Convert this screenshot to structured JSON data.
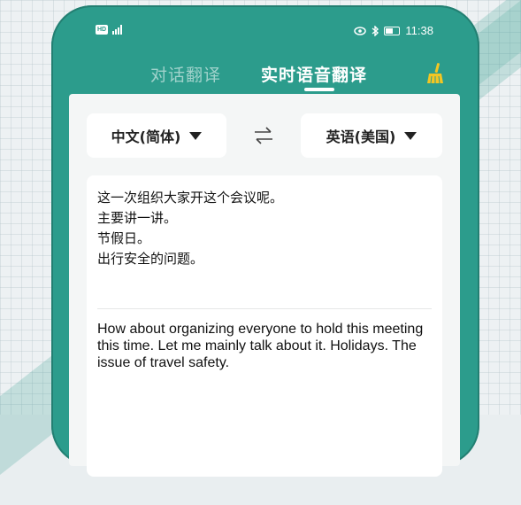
{
  "status_bar": {
    "time": "11:38",
    "network_badge": "HD",
    "signal_icon": "signal-icon",
    "eye_icon": "eye-icon",
    "bluetooth_icon": "bluetooth-icon",
    "battery_icon": "battery-icon"
  },
  "tabs": [
    {
      "label": "对话翻译",
      "active": false
    },
    {
      "label": "实时语音翻译",
      "active": true
    }
  ],
  "clear_icon": "broom-icon",
  "languages": {
    "source": "中文(简体)",
    "target": "英语(美国)",
    "swap_icon": "swap-arrows-icon"
  },
  "source_lines": [
    "这一次组织大家开这个会议呢。",
    "主要讲一讲。",
    "节假日。",
    "出行安全的问题。"
  ],
  "translation": "How about organizing everyone to hold this meeting this time. Let me mainly talk about it. Holidays. The issue of travel safety.",
  "colors": {
    "accent": "#2c9c8c",
    "card": "#f4f6f6"
  }
}
